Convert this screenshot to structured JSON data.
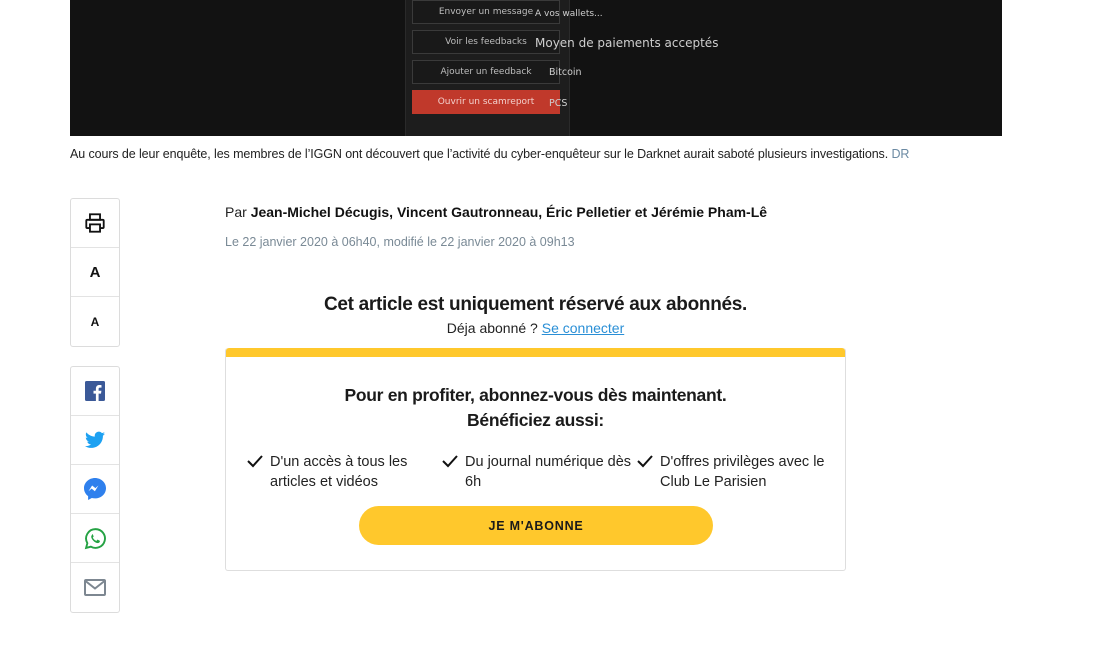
{
  "hero": {
    "menu": [
      "Envoyer un message",
      "Voir les feedbacks",
      "Ajouter un feedback",
      "Ouvrir un scamreport"
    ],
    "side": {
      "wallets": "A vos wallets...",
      "payments_heading": "Moyen de paiements acceptés",
      "pay1": "Bitcoin",
      "pay2": "PCS"
    }
  },
  "caption": {
    "text": "Au cours de leur enquête, les membres de l’IGGN ont découvert que l’activité du cyber-enquêteur sur le Darknet aurait saboté plusieurs investigations.",
    "credit": "DR"
  },
  "tools": {
    "font_large": "A",
    "font_small": "A"
  },
  "share_icons": [
    "facebook-icon",
    "twitter-icon",
    "messenger-icon",
    "whatsapp-icon",
    "email-icon"
  ],
  "colors": {
    "accent": "#ffc82c",
    "link": "#2a8fd6",
    "facebook": "#3b5998",
    "twitter": "#1da1f2",
    "messenger": "#2f80ed",
    "whatsapp": "#25a244",
    "email": "#7d8791"
  },
  "article": {
    "by_prefix": "Par",
    "authors": "Jean-Michel Décugis, Vincent Gautronneau, Éric Pelletier et Jérémie Pham-Lê",
    "date": "Le 22 janvier 2020 à 06h40, modifié le 22 janvier 2020 à 09h13"
  },
  "paywall": {
    "title": "Cet article est uniquement réservé aux abonnés.",
    "already": "Déja abonné ?",
    "login_link": "Se connecter",
    "offer_line1": "Pour en profiter, abonnez-vous dès maintenant.",
    "offer_line2": "Bénéficiez aussi:",
    "benefits": [
      "D'un accès à tous les articles et vidéos",
      "Du journal numérique dès 6h",
      "D'offres privilèges avec le Club Le Parisien"
    ],
    "cta": "JE M'ABONNE"
  }
}
